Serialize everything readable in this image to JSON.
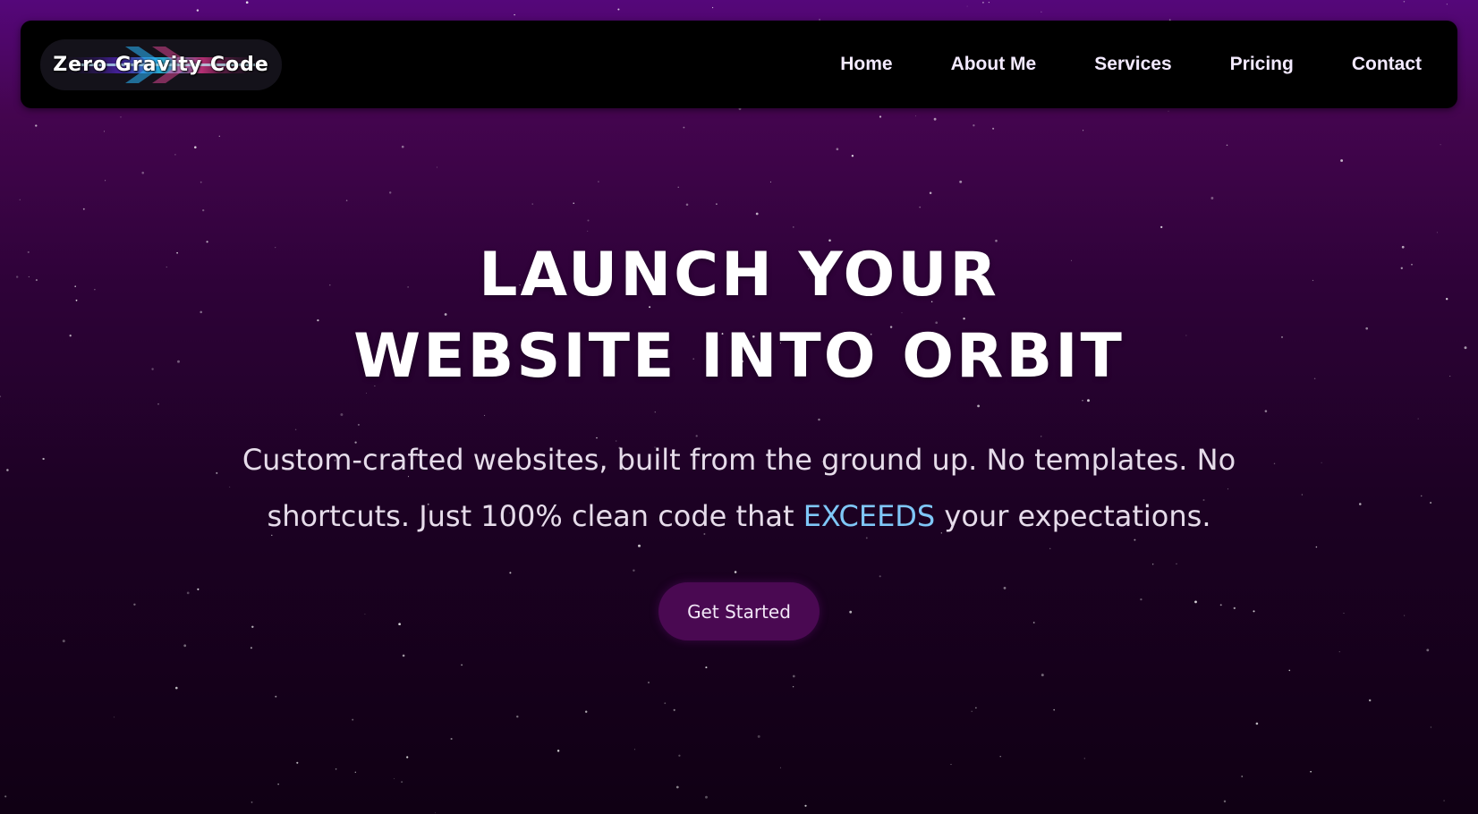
{
  "nav": {
    "logo_text": "Zero Gravity Code",
    "items": [
      {
        "label": "Home"
      },
      {
        "label": "About Me"
      },
      {
        "label": "Services"
      },
      {
        "label": "Pricing"
      },
      {
        "label": "Contact"
      }
    ]
  },
  "hero": {
    "title_line1": "LAUNCH YOUR",
    "title_line2": "WEBSITE INTO ORBIT",
    "subtitle_part1": "Custom-crafted websites, built from the ground up. No templates. No",
    "subtitle_part2": "shortcuts. Just 100% clean code that ",
    "subtitle_highlight": "EXCEEDS",
    "subtitle_part3": " your expectations.",
    "cta_label": "Get Started"
  },
  "colors": {
    "background_top": "#55077a",
    "background_bottom": "#100014",
    "navbar": "#000000",
    "highlight": "#7fc7f7",
    "cta_background": "#4a0952"
  }
}
